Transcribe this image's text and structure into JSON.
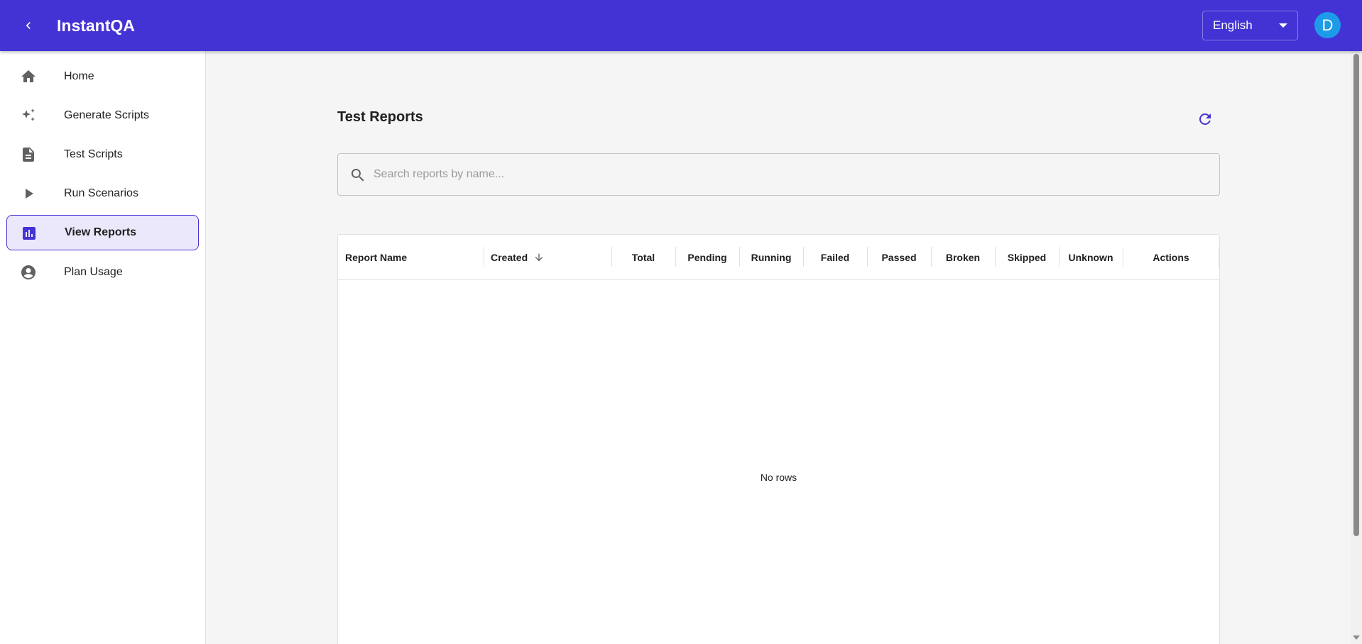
{
  "header": {
    "title": "InstantQA",
    "back_icon": "chevron-left-icon",
    "language": "English",
    "avatar_initial": "D",
    "colors": {
      "appbar": "#4433d4",
      "avatar": "#1e9be8"
    }
  },
  "sidebar": {
    "items": [
      {
        "label": "Home",
        "icon": "home-icon",
        "active": false
      },
      {
        "label": "Generate Scripts",
        "icon": "sparkles-icon",
        "active": false
      },
      {
        "label": "Test Scripts",
        "icon": "document-icon",
        "active": false
      },
      {
        "label": "Run Scenarios",
        "icon": "play-icon",
        "active": false
      },
      {
        "label": "View Reports",
        "icon": "bar-chart-icon",
        "active": true
      },
      {
        "label": "Plan Usage",
        "icon": "account-circle-icon",
        "active": false
      }
    ]
  },
  "main": {
    "title": "Test Reports",
    "refresh_icon": "refresh-icon",
    "search": {
      "placeholder": "Search reports by name...",
      "value": ""
    },
    "table": {
      "columns": [
        "Report Name",
        "Created",
        "Total",
        "Pending",
        "Running",
        "Failed",
        "Passed",
        "Broken",
        "Skipped",
        "Unknown",
        "Actions"
      ],
      "sorted_column": "Created",
      "sort_direction": "descending",
      "empty_message": "No rows"
    }
  }
}
